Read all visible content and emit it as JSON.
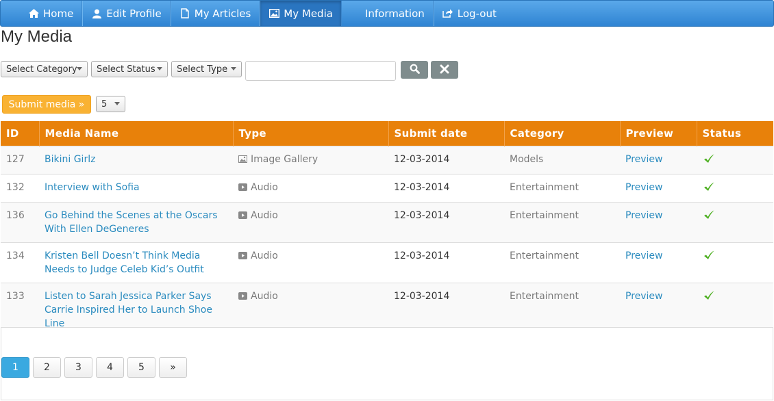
{
  "nav": {
    "items": [
      {
        "label": "Home",
        "icon": "home-icon"
      },
      {
        "label": "Edit Profile",
        "icon": "user-icon"
      },
      {
        "label": "My Articles",
        "icon": "document-icon"
      },
      {
        "label": "My Media",
        "icon": "image-icon"
      },
      {
        "label": "Information",
        "icon": ""
      },
      {
        "label": "Log-out",
        "icon": "logout-icon"
      }
    ],
    "active": "My Media"
  },
  "page": {
    "title": "My Media"
  },
  "filters": {
    "category": "Select Category",
    "status": "Select Status",
    "type": "Select Type",
    "search_value": "",
    "search_icon": "search-icon",
    "clear_icon": "close-icon"
  },
  "actions": {
    "submit_label": "Submit media »",
    "per_page": "5"
  },
  "table": {
    "headers": [
      "ID",
      "Media Name",
      "Type",
      "Submit date",
      "Category",
      "Preview",
      "Status"
    ],
    "rows": [
      {
        "id": "127",
        "name": "Bikini Girlz",
        "type": "Image Gallery",
        "type_icon": "image-icon",
        "date": "12-03-2014",
        "category": "Models",
        "preview": "Preview",
        "status": "approved"
      },
      {
        "id": "132",
        "name": "Interview with Sofia",
        "type": "Audio",
        "type_icon": "play-icon",
        "date": "12-03-2014",
        "category": "Entertainment",
        "preview": "Preview",
        "status": "approved"
      },
      {
        "id": "136",
        "name": "Go Behind the Scenes at the Oscars With Ellen DeGeneres",
        "type": "Audio",
        "type_icon": "play-icon",
        "date": "12-03-2014",
        "category": "Entertainment",
        "preview": "Preview",
        "status": "approved"
      },
      {
        "id": "134",
        "name": "Kristen Bell Doesn’t Think Media Needs to Judge Celeb Kid’s Outfit",
        "type": "Audio",
        "type_icon": "play-icon",
        "date": "12-03-2014",
        "category": "Entertainment",
        "preview": "Preview",
        "status": "approved"
      },
      {
        "id": "133",
        "name": "Listen to Sarah Jessica Parker Says Carrie Inspired Her to Launch Shoe Line",
        "type": "Audio",
        "type_icon": "play-icon",
        "date": "12-03-2014",
        "category": "Entertainment",
        "preview": "Preview",
        "status": "approved"
      }
    ]
  },
  "pagination": {
    "pages": [
      "1",
      "2",
      "3",
      "4",
      "5"
    ],
    "next": "»",
    "current": "1"
  },
  "colors": {
    "nav": "#3a8fdb",
    "header": "#e8810a",
    "submit": "#f9b233",
    "link": "#2a8bbf",
    "check": "#4caf1f",
    "page_active": "#3aa9e0"
  }
}
